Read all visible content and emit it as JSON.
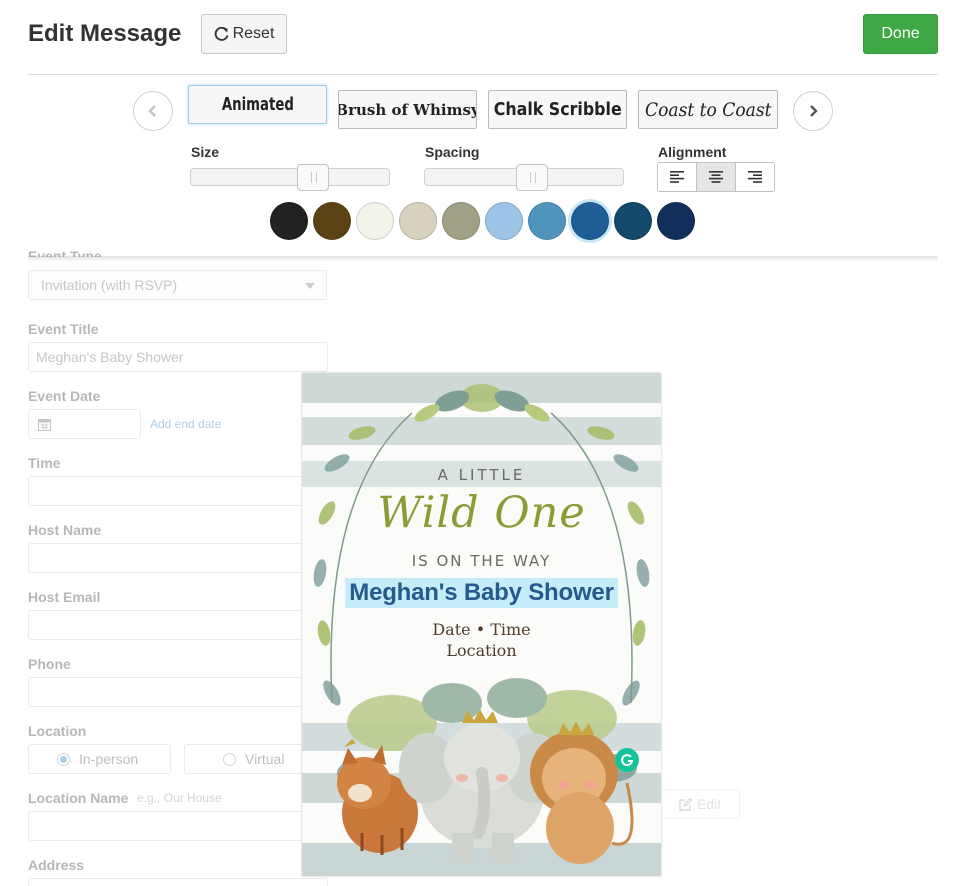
{
  "header": {
    "title": "Edit Message",
    "reset_label": "Reset",
    "done_label": "Done"
  },
  "fonts": [
    {
      "label": "Animated",
      "selected": true
    },
    {
      "label": "Brush of Whimsy",
      "selected": false
    },
    {
      "label": "Chalk Scribble",
      "selected": false
    },
    {
      "label": "Coast to Coast",
      "selected": false
    }
  ],
  "controls": {
    "size_label": "Size",
    "size_value_fraction": 0.64,
    "spacing_label": "Spacing",
    "spacing_value_fraction": 0.55,
    "alignment_label": "Alignment",
    "alignment_selected": "center"
  },
  "colors": {
    "swatches": [
      "#222222",
      "#5b4213",
      "#f4f3ea",
      "#d6d2bd",
      "#9fa086",
      "#9dc4e6",
      "#4f94bd",
      "#1f5e95",
      "#124a6b",
      "#13305c"
    ],
    "selected_index": 7,
    "accent_green": "#3ea845",
    "link_blue": "#3c8dbc"
  },
  "form": {
    "event_type_label": "Event Type",
    "event_type_value": "Invitation (with RSVP)",
    "event_title_label": "Event Title",
    "event_title_value": "Meghan's Baby Shower",
    "event_date_label": "Event Date",
    "add_end_date": "Add end date",
    "time_label": "Time",
    "host_name_label": "Host Name",
    "host_email_label": "Host Email",
    "phone_label": "Phone",
    "location_label": "Location",
    "in_person_label": "In-person",
    "virtual_label": "Virtual",
    "location_name_label": "Location Name",
    "location_name_placeholder": "e.g., Our House",
    "address_label": "Address",
    "edit_label": "Edit"
  },
  "card": {
    "line1": "A LITTLE",
    "line2": "Wild One",
    "line3": "IS ON THE WAY",
    "title": "Meghan's Baby Shower",
    "line5": "Date • Time",
    "line6": "Location"
  }
}
